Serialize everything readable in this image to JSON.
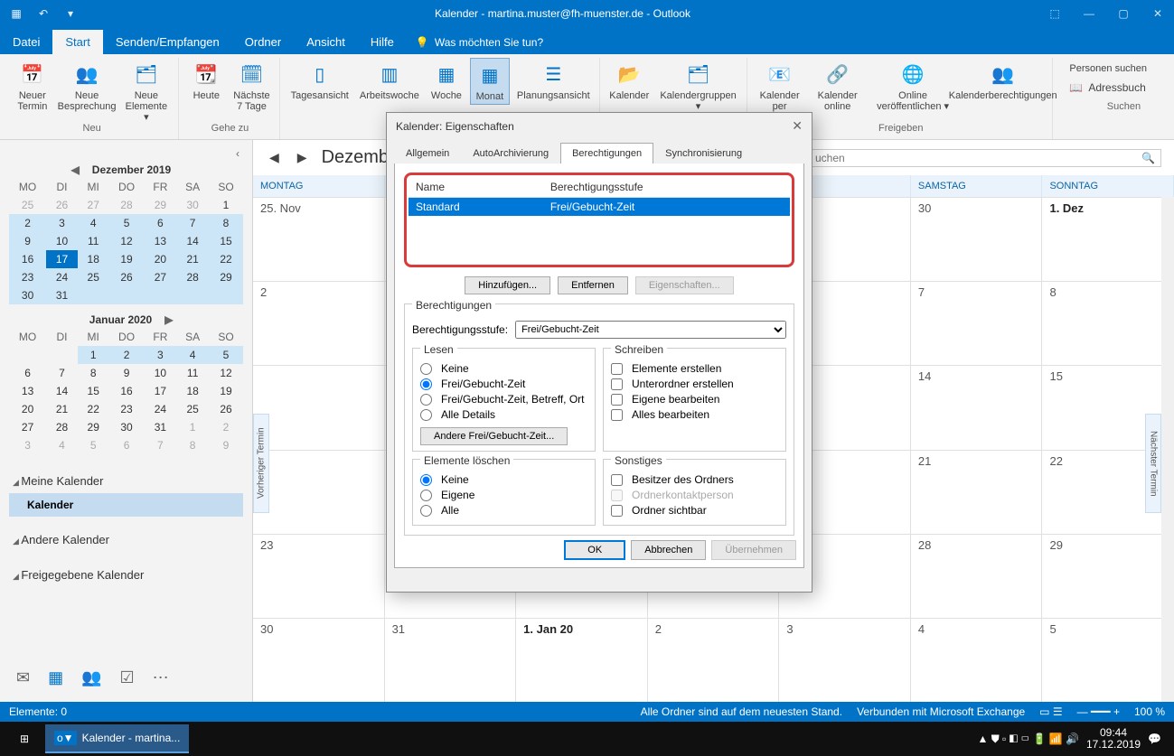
{
  "titlebar": {
    "title": "Kalender - martina.muster@fh-muenster.de  -  Outlook"
  },
  "menu": {
    "datei": "Datei",
    "start": "Start",
    "senden": "Senden/Empfangen",
    "ordner": "Ordner",
    "ansicht": "Ansicht",
    "hilfe": "Hilfe",
    "tell": "Was möchten Sie tun?"
  },
  "ribbon": {
    "neu": {
      "termin": "Neuer Termin",
      "bespr": "Neue Besprechung",
      "elem": "Neue Elemente ▾",
      "grp": "Neu"
    },
    "gehe": {
      "heute": "Heute",
      "n7": "Nächste 7 Tage",
      "grp": "Gehe zu"
    },
    "anord": {
      "tag": "Tagesansicht",
      "aw": "Arbeitswoche",
      "wo": "Woche",
      "mo": "Monat",
      "pl": "Planungsansicht"
    },
    "verw": {
      "kal": "Kalender",
      "kgrp": "Kalendergruppen ▾"
    },
    "frei": {
      "per": "Kalender per",
      "online": "Kalender online",
      "ver": "Online veröffentlichen ▾",
      "ber": "Kalenderberechtigungen",
      "grp": "Freigeben"
    },
    "such": {
      "ps": "Personen suchen",
      "ab": "Adressbuch",
      "grp": "Suchen"
    }
  },
  "minical1": {
    "title": "Dezember 2019",
    "dow": [
      "MO",
      "DI",
      "MI",
      "DO",
      "FR",
      "SA",
      "SO"
    ],
    "rows": [
      [
        "25",
        "26",
        "27",
        "28",
        "29",
        "30",
        "1"
      ],
      [
        "2",
        "3",
        "4",
        "5",
        "6",
        "7",
        "8"
      ],
      [
        "9",
        "10",
        "11",
        "12",
        "13",
        "14",
        "15"
      ],
      [
        "16",
        "17",
        "18",
        "19",
        "20",
        "21",
        "22"
      ],
      [
        "23",
        "24",
        "25",
        "26",
        "27",
        "28",
        "29"
      ],
      [
        "30",
        "31",
        "",
        "",
        "",
        "",
        ""
      ]
    ],
    "muteCells": [
      "0-0",
      "0-1",
      "0-2",
      "0-3",
      "0-4",
      "0-5"
    ],
    "todayCell": "3-1",
    "markRows": [
      1,
      2,
      3,
      4,
      5
    ]
  },
  "minical2": {
    "title": "Januar 2020",
    "dow": [
      "MO",
      "DI",
      "MI",
      "DO",
      "FR",
      "SA",
      "SO"
    ],
    "rows": [
      [
        "",
        "",
        "1",
        "2",
        "3",
        "4",
        "5"
      ],
      [
        "6",
        "7",
        "8",
        "9",
        "10",
        "11",
        "12"
      ],
      [
        "13",
        "14",
        "15",
        "16",
        "17",
        "18",
        "19"
      ],
      [
        "20",
        "21",
        "22",
        "23",
        "24",
        "25",
        "26"
      ],
      [
        "27",
        "28",
        "29",
        "30",
        "31",
        "1",
        "2"
      ],
      [
        "3",
        "4",
        "5",
        "6",
        "7",
        "8",
        "9"
      ]
    ],
    "muteCells": [
      "4-5",
      "4-6",
      "5-0",
      "5-1",
      "5-2",
      "5-3",
      "5-4",
      "5-5",
      "5-6"
    ],
    "markRow0": true
  },
  "callist": {
    "grp": "Meine Kalender",
    "sel": "Kalender",
    "other": "Andere Kalender",
    "shared": "Freigegebene Kalender"
  },
  "calview": {
    "month": "Dezemb",
    "search": "uchen",
    "days": [
      "MONTAG",
      "",
      "",
      "",
      "AG",
      "SAMSTAG",
      "SONNTAG"
    ],
    "weeks": [
      [
        "25. Nov",
        "",
        "",
        "",
        "",
        "30",
        "1. Dez"
      ],
      [
        "2",
        "",
        "",
        "",
        "",
        "7",
        "8"
      ],
      [
        "",
        "",
        "",
        "",
        "",
        "14",
        "15"
      ],
      [
        "",
        "",
        "",
        "",
        "",
        "21",
        "22"
      ],
      [
        "23",
        "",
        "",
        "",
        "",
        "28",
        "29"
      ],
      [
        "30",
        "31",
        "1. Jan 20",
        "2",
        "3",
        "4",
        "5"
      ]
    ],
    "prev": "Vorheriger Termin",
    "next": "Nächster Termin"
  },
  "status": {
    "el": "Elemente: 0",
    "sync": "Alle Ordner sind auf dem neuesten Stand.",
    "conn": "Verbunden mit Microsoft Exchange",
    "zoom": "100 %"
  },
  "taskbar": {
    "app": "Kalender - martina...",
    "time": "09:44",
    "date": "17.12.2019"
  },
  "dialog": {
    "title": "Kalender: Eigenschaften",
    "tabs": {
      "allg": "Allgemein",
      "auto": "AutoArchivierung",
      "ber": "Berechtigungen",
      "sync": "Synchronisierung"
    },
    "th1": "Name",
    "th2": "Berechtigungsstufe",
    "row_name": "Standard",
    "row_lvl": "Frei/Gebucht-Zeit",
    "add": "Hinzufügen...",
    "rem": "Entfernen",
    "prop": "Eigenschaften...",
    "perm_leg": "Berechtigungen",
    "lvl_lbl": "Berechtigungsstufe:",
    "lvl_val": "Frei/Gebucht-Zeit",
    "lesen": {
      "leg": "Lesen",
      "k": "Keine",
      "f": "Frei/Gebucht-Zeit",
      "fb": "Frei/Gebucht-Zeit, Betreff, Ort",
      "all": "Alle Details",
      "btn": "Andere Frei/Gebucht-Zeit..."
    },
    "schreiben": {
      "leg": "Schreiben",
      "e": "Elemente erstellen",
      "u": "Unterordner erstellen",
      "eb": "Eigene bearbeiten",
      "ab": "Alles bearbeiten"
    },
    "del": {
      "leg": "Elemente löschen",
      "k": "Keine",
      "e": "Eigene",
      "a": "Alle"
    },
    "sonst": {
      "leg": "Sonstiges",
      "b": "Besitzer des Ordners",
      "o": "Ordnerkontaktperson",
      "s": "Ordner sichtbar"
    },
    "ok": "OK",
    "cancel": "Abbrechen",
    "apply": "Übernehmen"
  }
}
